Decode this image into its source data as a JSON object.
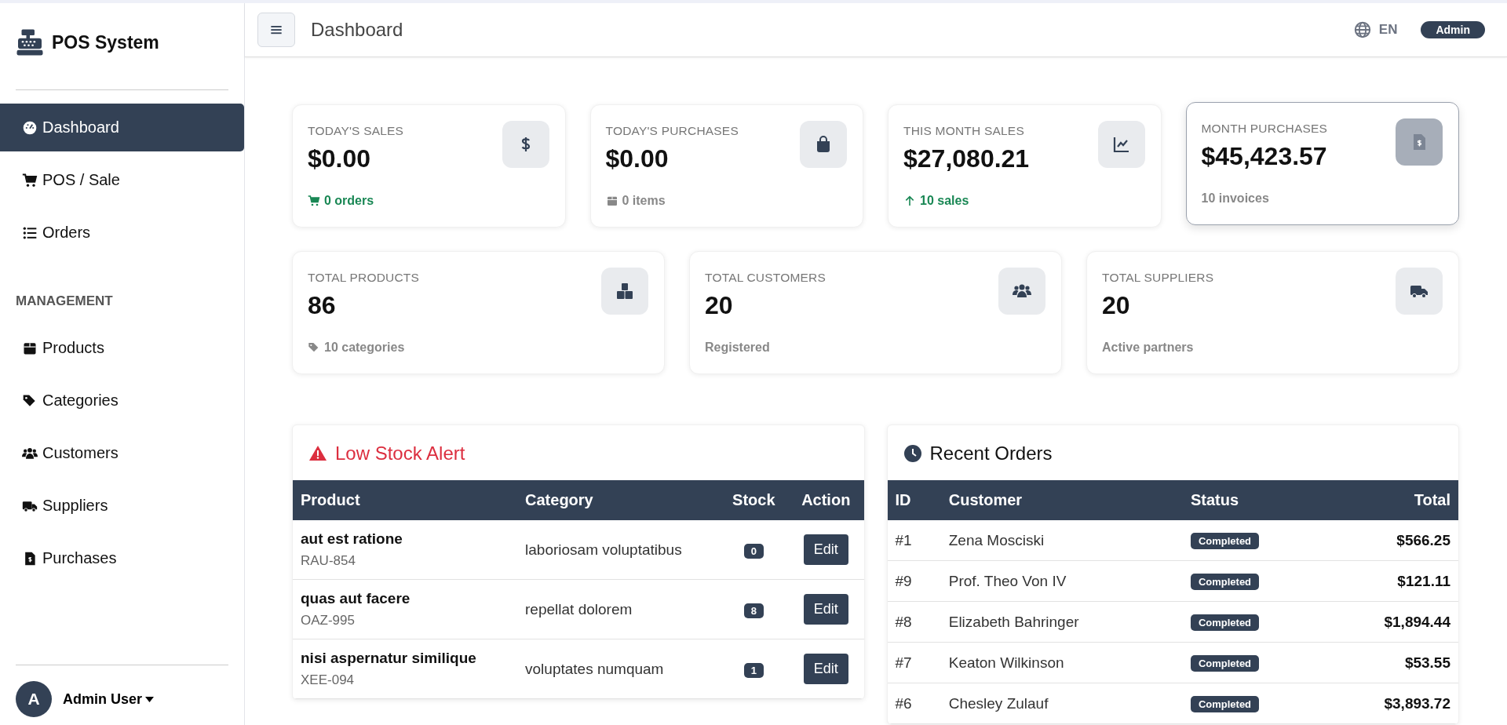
{
  "sidebar": {
    "brand": "POS System",
    "items": [
      {
        "label": "Dashboard",
        "selected": true
      },
      {
        "label": "POS / Sale",
        "selected": false
      },
      {
        "label": "Orders",
        "selected": false
      }
    ],
    "section_title": "MANAGEMENT",
    "management_items": [
      {
        "label": "Products",
        "selected": false
      },
      {
        "label": "Categories",
        "selected": false
      },
      {
        "label": "Customers",
        "selected": false
      },
      {
        "label": "Suppliers",
        "selected": false
      },
      {
        "label": "Purchases",
        "selected": false
      }
    ],
    "user": {
      "avatar": "A",
      "name": "Admin User"
    }
  },
  "topbar": {
    "title": "Dashboard",
    "language": "EN",
    "role": "Admin"
  },
  "stats_row_1": [
    {
      "label": "TODAY'S SALES",
      "value": "$0.00",
      "note": "0 orders",
      "color": "#198754",
      "hovered": false
    },
    {
      "label": "TODAY'S PURCHASES",
      "value": "$0.00",
      "note": "0 items",
      "color": "#888888",
      "hovered": false
    },
    {
      "label": "THIS MONTH SALES",
      "value": "$27,080.21",
      "note": "10 sales",
      "color": "#198754",
      "hovered": false
    },
    {
      "label": "MONTH PURCHASES",
      "value": "$45,423.57",
      "note": "10 invoices",
      "color": "#888888",
      "hovered": true
    }
  ],
  "stats_row_2": [
    {
      "label": "TOTAL PRODUCTS",
      "value": "86",
      "note": "10 categories",
      "color": "#888888",
      "hovered": false
    },
    {
      "label": "TOTAL CUSTOMERS",
      "value": "20",
      "note": "Registered",
      "color": "#888888",
      "hovered": false
    },
    {
      "label": "TOTAL SUPPLIERS",
      "value": "20",
      "note": "Active partners",
      "color": "#888888",
      "hovered": false
    }
  ],
  "low_stock": {
    "title": "Low Stock Alert",
    "columns": [
      "Product",
      "Category",
      "Stock",
      "Action"
    ],
    "rows": [
      {
        "product": "aut est ratione",
        "sku": "RAU-854",
        "category": "laboriosam voluptatibus",
        "stock": "0",
        "action": "Edit"
      },
      {
        "product": "quas aut facere",
        "sku": "OAZ-995",
        "category": "repellat dolorem",
        "stock": "8",
        "action": "Edit"
      },
      {
        "product": "nisi aspernatur similique",
        "sku": "XEE-094",
        "category": "voluptates numquam",
        "stock": "1",
        "action": "Edit"
      }
    ]
  },
  "recent_orders": {
    "title": "Recent Orders",
    "columns": [
      "ID",
      "Customer",
      "Status",
      "Total"
    ],
    "rows": [
      {
        "id": "#1",
        "customer": "Zena Mosciski",
        "status": "Completed",
        "total": "$566.25"
      },
      {
        "id": "#9",
        "customer": "Prof. Theo Von IV",
        "status": "Completed",
        "total": "$121.11"
      },
      {
        "id": "#8",
        "customer": "Elizabeth Bahringer",
        "status": "Completed",
        "total": "$1,894.44"
      },
      {
        "id": "#7",
        "customer": "Keaton Wilkinson",
        "status": "Completed",
        "total": "$53.55"
      },
      {
        "id": "#6",
        "customer": "Chesley Zulauf",
        "status": "Completed",
        "total": "$3,893.72"
      }
    ]
  }
}
